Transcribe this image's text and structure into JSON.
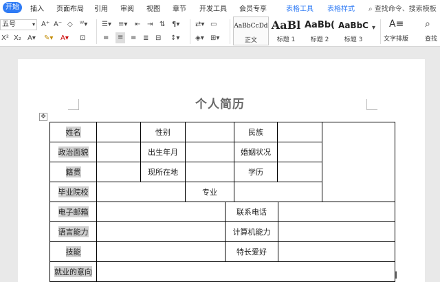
{
  "ribbon": {
    "tabs": [
      "开始",
      "插入",
      "页面布局",
      "引用",
      "审阅",
      "视图",
      "章节",
      "开发工具",
      "会员专享",
      "表格工具",
      "表格样式"
    ],
    "search_placeholder": "查找命令、搜索模板"
  },
  "toolbar": {
    "font_size": "五号",
    "styles": [
      {
        "sample": "AaBbCcDd",
        "label": "正文"
      },
      {
        "sample": "AaBl",
        "label": "标题 1"
      },
      {
        "sample": "AaBb(",
        "label": "标题 2"
      },
      {
        "sample": "AaBbC",
        "label": "标题 3"
      }
    ],
    "text_layout": "文字排版",
    "find_replace": "查找"
  },
  "document": {
    "title": "个人简历",
    "table": [
      "姓名",
      "性别",
      "民族",
      "政治面貌",
      "出生年月",
      "婚姻状况",
      "籍贯",
      "现所在地",
      "学历",
      "毕业院校",
      "专业",
      "电子邮箱",
      "联系电话",
      "语言能力",
      "计算机能力",
      "技能",
      "特长爱好",
      "就业的意向"
    ]
  },
  "colors": {
    "accent": "#2f7bf5",
    "cell_highlight": "#cfcfcf"
  }
}
